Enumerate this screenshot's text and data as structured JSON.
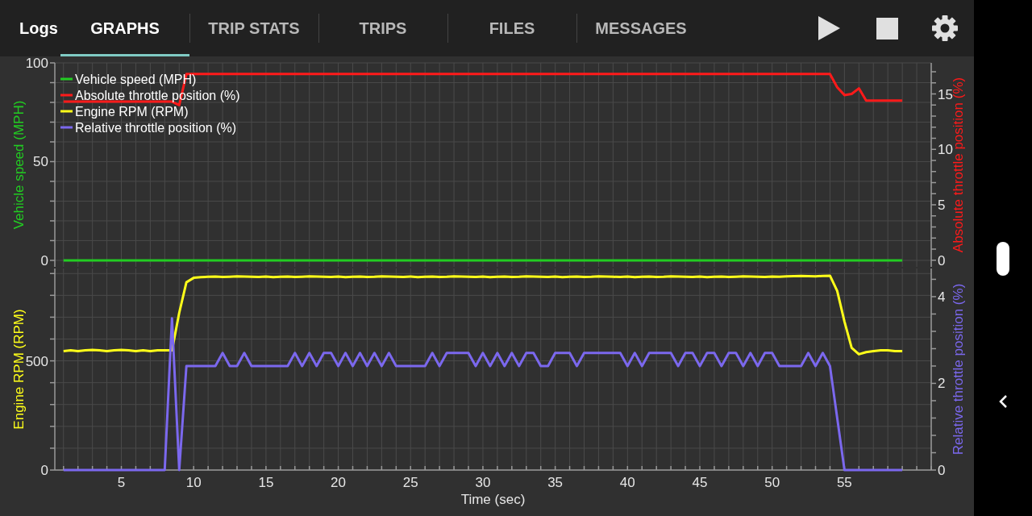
{
  "top_bar": {
    "title": "Logs",
    "tabs": [
      {
        "label": "GRAPHS",
        "selected": true
      },
      {
        "label": "TRIP STATS",
        "selected": false
      },
      {
        "label": "TRIPS",
        "selected": false
      },
      {
        "label": "FILES",
        "selected": false
      },
      {
        "label": "MESSAGES",
        "selected": false
      }
    ],
    "actions": [
      {
        "kind": "play"
      },
      {
        "kind": "stop"
      },
      {
        "kind": "settings"
      }
    ]
  },
  "graphs": [
    {
      "chart_data": {
        "type": "line",
        "grid": true,
        "legend": "upper left",
        "ylabel": "Vehicle speed (MPH)",
        "y2label": "Absolute throttle position (%)",
        "xlim": [
          0.4,
          61
        ],
        "ylim": [
          -3.3,
          100
        ],
        "y2lim": [
          -0.6,
          17.8
        ],
        "yticks": [
          0,
          50,
          100
        ],
        "y2ticks": [
          0,
          5,
          10,
          15
        ],
        "x": [
          1,
          1.5,
          2,
          2.5,
          3,
          3.5,
          4,
          4.5,
          5,
          5.5,
          6,
          6.5,
          7,
          7.5,
          8,
          8.5,
          9,
          9.5,
          10,
          10.5,
          11,
          11.5,
          12,
          12.5,
          13,
          13.5,
          14,
          14.5,
          15,
          15.5,
          16,
          16.5,
          17,
          17.5,
          18,
          18.5,
          19,
          19.5,
          20,
          20.5,
          21,
          21.5,
          22,
          22.5,
          23,
          23.5,
          24,
          24.5,
          25,
          25.5,
          26,
          26.5,
          27,
          27.5,
          28,
          28.5,
          29,
          29.5,
          30,
          30.5,
          31,
          31.5,
          32,
          32.5,
          33,
          33.5,
          34,
          34.5,
          35,
          35.5,
          36,
          36.5,
          37,
          37.5,
          38,
          38.5,
          39,
          39.5,
          40,
          40.5,
          41,
          41.5,
          42,
          42.5,
          43,
          43.5,
          44,
          44.5,
          45,
          45.5,
          46,
          46.5,
          47,
          47.5,
          48,
          48.5,
          49,
          49.5,
          50,
          50.5,
          51,
          51.5,
          52,
          52.5,
          53,
          53.5,
          54,
          54.5,
          55,
          55.5,
          56,
          56.5,
          57,
          57.5,
          58,
          58.5,
          59
        ],
        "series": [
          {
            "name": "Vehicle speed (MPH)",
            "color": "#22cc22",
            "values": [
              0,
              0,
              0,
              0,
              0,
              0,
              0,
              0,
              0,
              0,
              0,
              0,
              0,
              0,
              0,
              0,
              0,
              0,
              0,
              0,
              0,
              0,
              0,
              0,
              0,
              0,
              0,
              0,
              0,
              0,
              0,
              0,
              0,
              0,
              0,
              0,
              0,
              0,
              0,
              0,
              0,
              0,
              0,
              0,
              0,
              0,
              0,
              0,
              0,
              0,
              0,
              0,
              0,
              0,
              0,
              0,
              0,
              0,
              0,
              0,
              0,
              0,
              0,
              0,
              0,
              0,
              0,
              0,
              0,
              0,
              0,
              0,
              0,
              0,
              0,
              0,
              0,
              0,
              0,
              0,
              0,
              0,
              0,
              0,
              0,
              0,
              0,
              0,
              0,
              0,
              0,
              0,
              0,
              0,
              0,
              0,
              0,
              0,
              0,
              0,
              0,
              0,
              0,
              0,
              0,
              0,
              0,
              0,
              0,
              0,
              0,
              0,
              0,
              0,
              0,
              0,
              0
            ]
          },
          {
            "name": "Absolute throttle position (%)",
            "color": "#ff1a1a",
            "axis": "y2",
            "values": [
              14.3,
              14.3,
              14.3,
              14.3,
              14.3,
              14.3,
              14.3,
              14.3,
              14.3,
              14.3,
              14.3,
              14.3,
              14.3,
              14.3,
              14.3,
              14.3,
              14.0,
              16.8,
              16.8,
              16.8,
              16.8,
              16.8,
              16.8,
              16.8,
              16.8,
              16.8,
              16.8,
              16.8,
              16.8,
              16.8,
              16.8,
              16.8,
              16.8,
              16.8,
              16.8,
              16.8,
              16.8,
              16.8,
              16.8,
              16.8,
              16.8,
              16.8,
              16.8,
              16.8,
              16.8,
              16.8,
              16.8,
              16.8,
              16.8,
              16.8,
              16.8,
              16.8,
              16.8,
              16.8,
              16.8,
              16.8,
              16.8,
              16.8,
              16.8,
              16.8,
              16.8,
              16.8,
              16.8,
              16.8,
              16.8,
              16.8,
              16.8,
              16.8,
              16.8,
              16.8,
              16.8,
              16.8,
              16.8,
              16.8,
              16.8,
              16.8,
              16.8,
              16.8,
              16.8,
              16.8,
              16.8,
              16.8,
              16.8,
              16.8,
              16.8,
              16.8,
              16.8,
              16.8,
              16.8,
              16.8,
              16.8,
              16.8,
              16.8,
              16.8,
              16.8,
              16.8,
              16.8,
              16.8,
              16.8,
              16.8,
              16.8,
              16.8,
              16.8,
              16.8,
              16.8,
              16.8,
              16.8,
              15.6,
              14.9,
              15.0,
              15.5,
              14.4,
              14.4,
              14.4,
              14.4,
              14.4,
              14.4
            ]
          }
        ]
      }
    },
    {
      "chart_data": {
        "type": "line",
        "grid": true,
        "xlabel": "Time (sec)",
        "ylabel": "Engine RPM (RPM)",
        "y2label": "Relative throttle position (%)",
        "xlim": [
          0.4,
          61
        ],
        "ylim": [
          0,
          923
        ],
        "y2lim": [
          0,
          4.65
        ],
        "xticks": [
          5,
          10,
          15,
          20,
          25,
          30,
          35,
          40,
          45,
          50,
          55
        ],
        "yticks": [
          0,
          500
        ],
        "y2ticks": [
          0,
          2,
          4
        ],
        "x": [
          1,
          1.5,
          2,
          2.5,
          3,
          3.5,
          4,
          4.5,
          5,
          5.5,
          6,
          6.5,
          7,
          7.5,
          8,
          8.5,
          9,
          9.5,
          10,
          10.5,
          11,
          11.5,
          12,
          12.5,
          13,
          13.5,
          14,
          14.5,
          15,
          15.5,
          16,
          16.5,
          17,
          17.5,
          18,
          18.5,
          19,
          19.5,
          20,
          20.5,
          21,
          21.5,
          22,
          22.5,
          23,
          23.5,
          24,
          24.5,
          25,
          25.5,
          26,
          26.5,
          27,
          27.5,
          28,
          28.5,
          29,
          29.5,
          30,
          30.5,
          31,
          31.5,
          32,
          32.5,
          33,
          33.5,
          34,
          34.5,
          35,
          35.5,
          36,
          36.5,
          37,
          37.5,
          38,
          38.5,
          39,
          39.5,
          40,
          40.5,
          41,
          41.5,
          42,
          42.5,
          43,
          43.5,
          44,
          44.5,
          45,
          45.5,
          46,
          46.5,
          47,
          47.5,
          48,
          48.5,
          49,
          49.5,
          50,
          50.5,
          51,
          51.5,
          52,
          52.5,
          53,
          53.5,
          54,
          54.5,
          55,
          55.5,
          56,
          56.5,
          57,
          57.5,
          58,
          58.5,
          59
        ],
        "series": [
          {
            "name": "Engine RPM (RPM)",
            "color": "#ffff1a",
            "values": [
              545,
              548,
              545,
              548,
              550,
              548,
              545,
              548,
              550,
              548,
              545,
              548,
              545,
              548,
              548,
              548,
              720,
              860,
              880,
              883,
              885,
              886,
              884,
              885,
              887,
              886,
              885,
              884,
              886,
              883,
              885,
              886,
              884,
              885,
              887,
              886,
              885,
              884,
              886,
              883,
              885,
              886,
              884,
              885,
              887,
              886,
              885,
              884,
              886,
              883,
              885,
              886,
              884,
              885,
              887,
              886,
              885,
              884,
              886,
              883,
              885,
              886,
              884,
              885,
              887,
              886,
              885,
              884,
              886,
              883,
              885,
              886,
              884,
              885,
              887,
              886,
              885,
              884,
              886,
              883,
              885,
              886,
              884,
              885,
              887,
              886,
              885,
              884,
              886,
              883,
              885,
              886,
              884,
              885,
              887,
              886,
              885,
              884,
              886,
              885,
              887,
              888,
              889,
              888,
              887,
              889,
              890,
              820,
              680,
              560,
              530,
              540,
              545,
              548,
              548,
              545,
              545
            ]
          },
          {
            "name": "Relative throttle position (%)",
            "color": "#7b68ee",
            "axis": "y2",
            "values": [
              0,
              0,
              0,
              0,
              0,
              0,
              0,
              0,
              0,
              0,
              0,
              0,
              0,
              0,
              0,
              3.5,
              0,
              2.4,
              2.4,
              2.4,
              2.4,
              2.4,
              2.7,
              2.4,
              2.4,
              2.7,
              2.4,
              2.4,
              2.4,
              2.4,
              2.4,
              2.4,
              2.7,
              2.4,
              2.7,
              2.4,
              2.7,
              2.7,
              2.4,
              2.7,
              2.4,
              2.7,
              2.4,
              2.7,
              2.4,
              2.7,
              2.4,
              2.4,
              2.4,
              2.4,
              2.4,
              2.7,
              2.4,
              2.7,
              2.7,
              2.7,
              2.7,
              2.4,
              2.7,
              2.4,
              2.7,
              2.4,
              2.7,
              2.4,
              2.7,
              2.7,
              2.4,
              2.4,
              2.7,
              2.7,
              2.7,
              2.4,
              2.7,
              2.7,
              2.7,
              2.7,
              2.7,
              2.7,
              2.4,
              2.7,
              2.4,
              2.7,
              2.7,
              2.7,
              2.7,
              2.4,
              2.7,
              2.7,
              2.4,
              2.7,
              2.7,
              2.4,
              2.7,
              2.7,
              2.4,
              2.7,
              2.4,
              2.7,
              2.7,
              2.4,
              2.4,
              2.4,
              2.4,
              2.7,
              2.4,
              2.7,
              2.4,
              1.2,
              0,
              0,
              0,
              0,
              0,
              0,
              0,
              0,
              0
            ]
          }
        ]
      }
    }
  ]
}
